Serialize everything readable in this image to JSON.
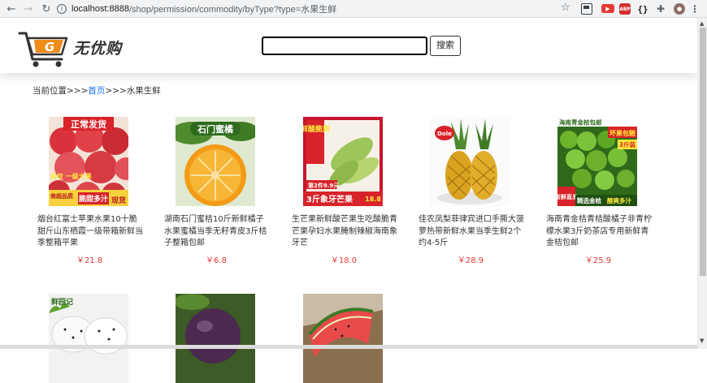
{
  "browser": {
    "url_host": "localhost:8888",
    "url_path": "/shop/permission/commodity/byType?type=水果生鲜"
  },
  "site": {
    "brand": "无优购",
    "logo_letter": "G",
    "search_placeholder": "",
    "search_button": "搜索"
  },
  "breadcrumb": {
    "prefix": "当前位置>>>",
    "home": "首页",
    "separator": ">>>",
    "current": "水果生鲜"
  },
  "products": [
    {
      "title": "烟台红富士苹果水果10十脆甜斤山东栖霞一级带箱新鲜当季整箱平果",
      "price": "￥21.8",
      "img_banner": "正常发货",
      "img_tag1": "条纹 一级大果",
      "img_tag2": "商超品质",
      "img_tag3": "脆甜多汁",
      "img_tag4": "现货"
    },
    {
      "title": "湖南石门蜜桔10斤新鲜橘子水果蜜橘当季无籽青皮3斤桔子整箱包邮",
      "price": "￥6.8",
      "img_banner": "石门蜜橘"
    },
    {
      "title": "生芒果新鲜酸芒果生吃酸脆青芒果孕妇水果腌制辣椒海南象牙芒",
      "price": "￥18.0",
      "img_banner": "鲜酸脆爽",
      "img_tag1": "第2件9.9元",
      "img_tag2": "3斤象牙芒果",
      "img_tag3": "18.8"
    },
    {
      "title": "佳农凤梨菲律宾进口手撕大菠萝热带新鲜水果当季生鲜2个约4-5斤",
      "price": "￥28.9",
      "img_badge": "Dole"
    },
    {
      "title": "海南青金桔青桔酸橘子非青柠檬水果3斤奶茶店专用新鲜青金桔包邮",
      "price": "￥25.9",
      "img_banner": "海南青金桔包邮",
      "img_tag1": "坏果包赔",
      "img_tag2": "3斤装",
      "img_tag3": "新鲜直发",
      "img_tag4": "精选金桔",
      "img_tag5": "酸爽多汁"
    },
    {
      "title": "",
      "price": "",
      "img_banner": "鲜园记"
    },
    {
      "title": "",
      "price": ""
    },
    {
      "title": "",
      "price": ""
    }
  ],
  "colors": {
    "price": "#e53935",
    "link": "#1a73e8",
    "logo_orange": "#f08c1a"
  }
}
